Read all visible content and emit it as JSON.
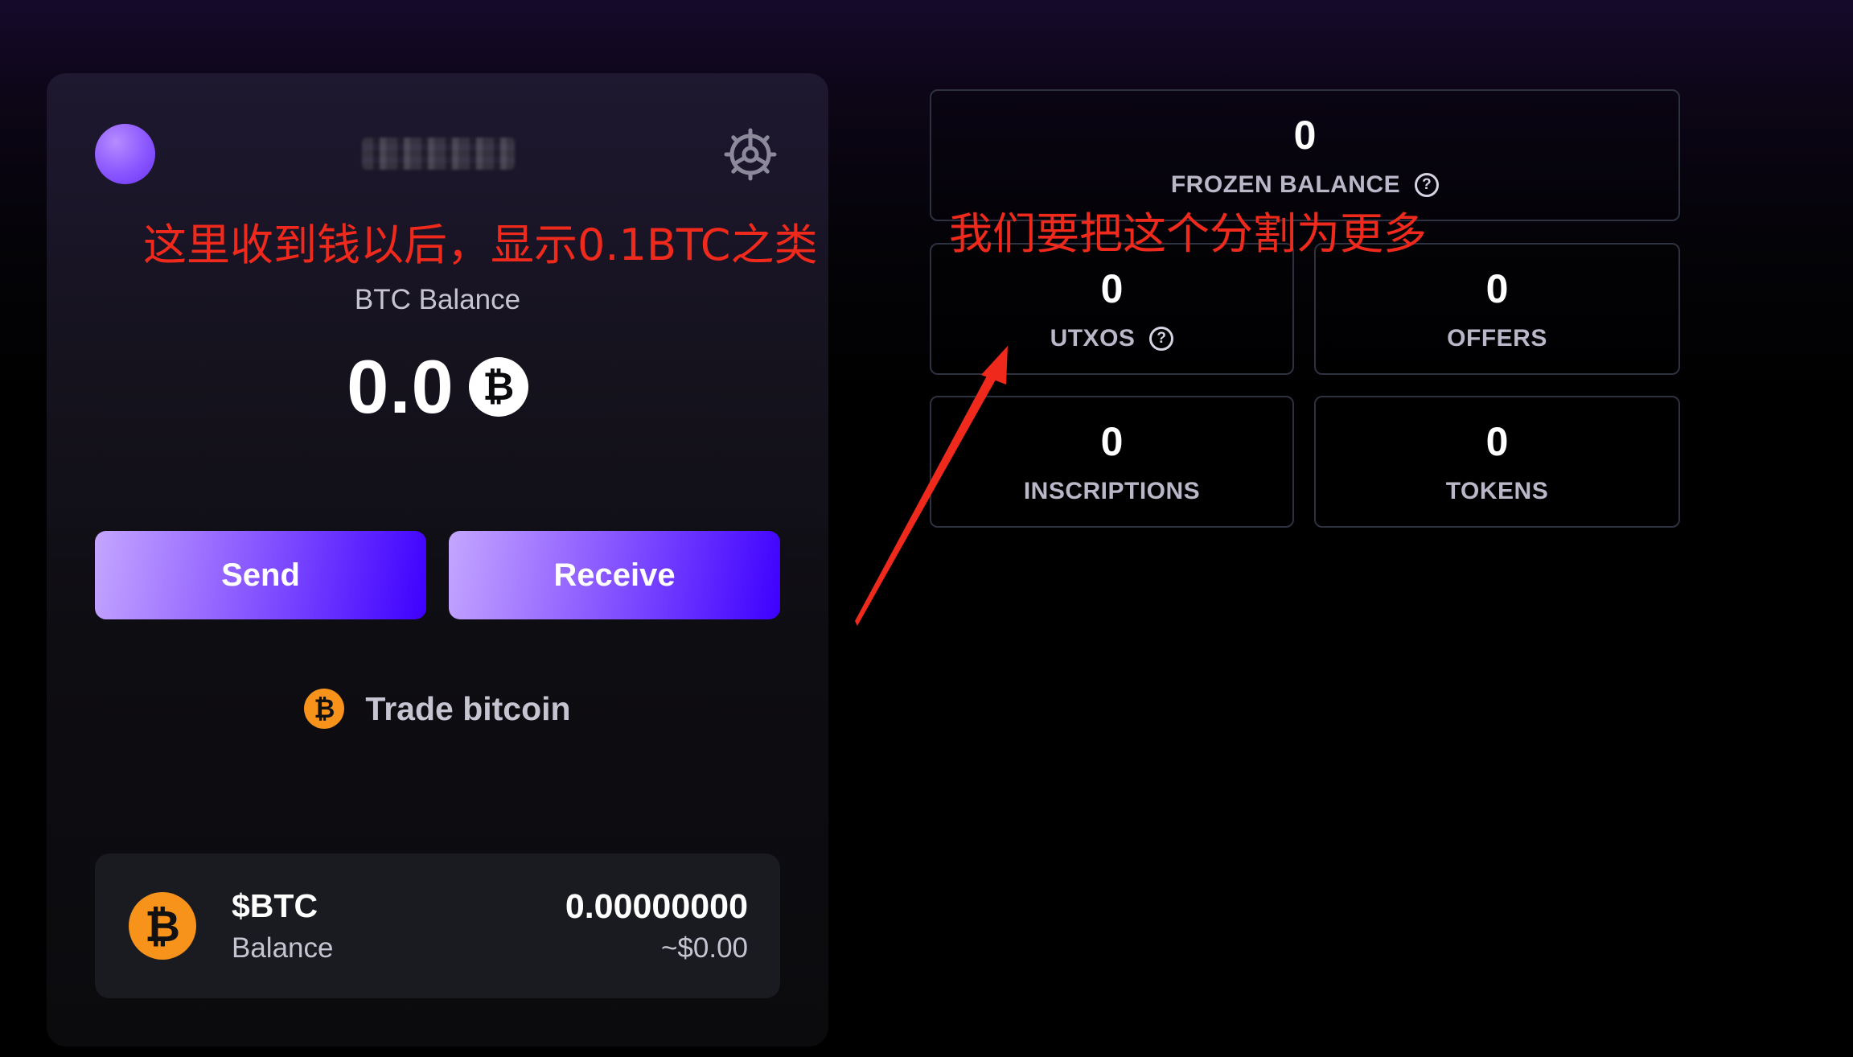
{
  "wallet": {
    "balance_label": "BTC Balance",
    "balance_value": "0.0",
    "currency_symbol": "₿",
    "actions": {
      "send": "Send",
      "receive": "Receive"
    },
    "trade_link": "Trade bitcoin",
    "asset": {
      "symbol": "$BTC",
      "sub_label": "Balance",
      "amount": "0.00000000",
      "fiat": "~$0.00",
      "icon_glyph": "₿"
    }
  },
  "stats": {
    "frozen": {
      "value": "0",
      "label": "FROZEN BALANCE",
      "help": "?"
    },
    "utxos": {
      "value": "0",
      "label": "UTXOS",
      "help": "?"
    },
    "offers": {
      "value": "0",
      "label": "OFFERS"
    },
    "inscriptions": {
      "value": "0",
      "label": "INSCRIPTIONS"
    },
    "tokens": {
      "value": "0",
      "label": "TOKENS"
    }
  },
  "annotations": {
    "left_note": "这里收到钱以后，显示0.1BTC之类",
    "right_note": "我们要把这个分割为更多"
  },
  "colors": {
    "accent_purple": "#8c5bff",
    "accent_blue": "#3d00ff",
    "bitcoin_orange": "#f7931a",
    "annotation_red": "#ef2a1c",
    "tile_border": "#2e3140"
  }
}
